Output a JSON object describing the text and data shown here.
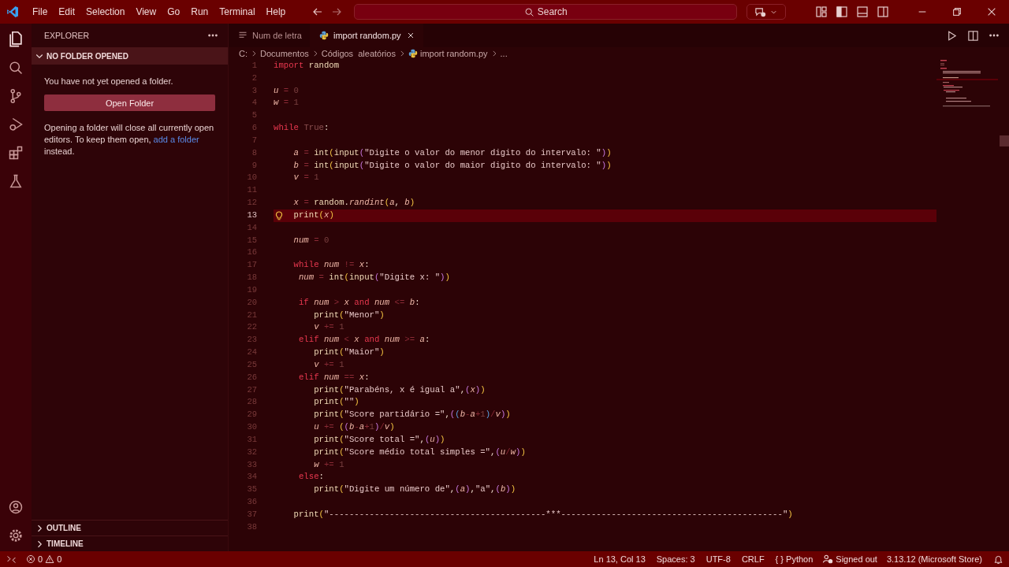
{
  "title_bar": {
    "menus": [
      "File",
      "Edit",
      "Selection",
      "View",
      "Go",
      "Run",
      "Terminal",
      "Help"
    ],
    "search": {
      "placeholder": "Search"
    }
  },
  "explorer": {
    "title": "EXPLORER",
    "section": {
      "title": "NO FOLDER OPENED",
      "expanded": true,
      "message": "You have not yet opened a folder.",
      "button": "Open Folder",
      "note_before": "Opening a folder will close all currently open editors. To keep them open, ",
      "note_link": "add a folder",
      "note_after": " instead."
    },
    "bottom_sections": [
      {
        "title": "OUTLINE",
        "expanded": false
      },
      {
        "title": "TIMELINE",
        "expanded": false
      }
    ]
  },
  "tabs": [
    {
      "label": "Num de letra",
      "kind": "text",
      "selected": false
    },
    {
      "label": "import random.py",
      "kind": "python",
      "selected": true
    }
  ],
  "breadcrumbs": [
    {
      "label": "C:",
      "kind": "folder"
    },
    {
      "label": "Documentos",
      "kind": "folder"
    },
    {
      "label": "Códigos  aleatórios",
      "kind": "folder"
    },
    {
      "label": "import random.py",
      "kind": "python"
    },
    {
      "label": "...",
      "kind": "more"
    }
  ],
  "editor": {
    "lines": [
      {
        "number": "1",
        "current": false,
        "tokens": [
          {
            "kind": "kw",
            "text": "import"
          },
          {
            "kind": "name",
            "text": " random"
          }
        ]
      },
      {
        "number": "2",
        "current": false
      },
      {
        "number": "3",
        "current": false,
        "tokens": [
          {
            "kind": "var",
            "text": "u"
          },
          {
            "kind": "op",
            "text": " = "
          },
          {
            "kind": "num",
            "text": "0"
          }
        ]
      },
      {
        "number": "4",
        "current": false,
        "tokens": [
          {
            "kind": "var",
            "text": "w"
          },
          {
            "kind": "op",
            "text": " = "
          },
          {
            "kind": "num",
            "text": "1"
          }
        ]
      },
      {
        "number": "5",
        "current": false
      },
      {
        "number": "6",
        "current": false,
        "tokens": [
          {
            "kind": "kw",
            "text": "while"
          },
          {
            "kind": "const",
            "text": " True"
          },
          {
            "kind": "punct",
            "text": ":"
          }
        ]
      },
      {
        "number": "7",
        "current": false
      },
      {
        "number": "8",
        "current": false,
        "tokens": [
          {
            "kind": "var",
            "text": "    a"
          },
          {
            "kind": "op",
            "text": " = "
          },
          {
            "kind": "name",
            "text": "int"
          },
          {
            "kind": "paren",
            "text": "("
          },
          {
            "kind": "name",
            "text": "input"
          },
          {
            "kind": "paren2",
            "text": "("
          },
          {
            "kind": "str",
            "text": "\"Digite o valor do menor digito do intervalo: \""
          },
          {
            "kind": "paren2",
            "text": ")"
          },
          {
            "kind": "paren",
            "text": ")"
          }
        ]
      },
      {
        "number": "9",
        "current": false,
        "tokens": [
          {
            "kind": "var",
            "text": "    b"
          },
          {
            "kind": "op",
            "text": " = "
          },
          {
            "kind": "name",
            "text": "int"
          },
          {
            "kind": "paren",
            "text": "("
          },
          {
            "kind": "name",
            "text": "input"
          },
          {
            "kind": "paren2",
            "text": "("
          },
          {
            "kind": "str",
            "text": "\"Digite o valor do maior digito do intervalo: \""
          },
          {
            "kind": "paren2",
            "text": ")"
          },
          {
            "kind": "paren",
            "text": ")"
          }
        ]
      },
      {
        "number": "10",
        "current": false,
        "tokens": [
          {
            "kind": "var",
            "text": "    v"
          },
          {
            "kind": "op",
            "text": " = "
          },
          {
            "kind": "num",
            "text": "1"
          }
        ]
      },
      {
        "number": "11",
        "current": false
      },
      {
        "number": "12",
        "current": false,
        "tokens": [
          {
            "kind": "var",
            "text": "    x"
          },
          {
            "kind": "op",
            "text": " = "
          },
          {
            "kind": "name",
            "text": "random"
          },
          {
            "kind": "punct",
            "text": "."
          },
          {
            "kind": "method",
            "text": "randint"
          },
          {
            "kind": "paren",
            "text": "("
          },
          {
            "kind": "var",
            "text": "a"
          },
          {
            "kind": "punct",
            "text": ", "
          },
          {
            "kind": "var",
            "text": "b"
          },
          {
            "kind": "paren",
            "text": ")"
          }
        ]
      },
      {
        "number": "13",
        "current": true,
        "tokens": [
          {
            "kind": "name",
            "text": "    print"
          },
          {
            "kind": "paren",
            "text": "("
          },
          {
            "kind": "var",
            "text": "x"
          },
          {
            "kind": "paren",
            "text": ")"
          }
        ]
      },
      {
        "number": "14",
        "current": false
      },
      {
        "number": "15",
        "current": false,
        "tokens": [
          {
            "kind": "var",
            "text": "    num"
          },
          {
            "kind": "op",
            "text": " = "
          },
          {
            "kind": "num",
            "text": "0"
          }
        ]
      },
      {
        "number": "16",
        "current": false
      },
      {
        "number": "17",
        "current": false,
        "tokens": [
          {
            "kind": "kw",
            "text": "    while"
          },
          {
            "kind": "var",
            "text": " num"
          },
          {
            "kind": "op",
            "text": " != "
          },
          {
            "kind": "var",
            "text": "x"
          },
          {
            "kind": "punct",
            "text": ":"
          }
        ]
      },
      {
        "number": "18",
        "current": false,
        "tokens": [
          {
            "kind": "var",
            "text": "     num"
          },
          {
            "kind": "op",
            "text": " = "
          },
          {
            "kind": "name",
            "text": "int"
          },
          {
            "kind": "paren",
            "text": "("
          },
          {
            "kind": "name",
            "text": "input"
          },
          {
            "kind": "paren2",
            "text": "("
          },
          {
            "kind": "str",
            "text": "\"Digite x: \""
          },
          {
            "kind": "paren2",
            "text": ")"
          },
          {
            "kind": "paren",
            "text": ")"
          }
        ]
      },
      {
        "number": "19",
        "current": false
      },
      {
        "number": "20",
        "current": false,
        "tokens": [
          {
            "kind": "kw",
            "text": "     if"
          },
          {
            "kind": "var",
            "text": " num"
          },
          {
            "kind": "op",
            "text": " > "
          },
          {
            "kind": "var",
            "text": "x"
          },
          {
            "kind": "kw",
            "text": " and"
          },
          {
            "kind": "var",
            "text": " num"
          },
          {
            "kind": "op",
            "text": " <= "
          },
          {
            "kind": "var",
            "text": "b"
          },
          {
            "kind": "punct",
            "text": ":"
          }
        ]
      },
      {
        "number": "21",
        "current": false,
        "tokens": [
          {
            "kind": "name",
            "text": "        print"
          },
          {
            "kind": "paren",
            "text": "("
          },
          {
            "kind": "str",
            "text": "\"Menor\""
          },
          {
            "kind": "paren",
            "text": ")"
          }
        ]
      },
      {
        "number": "22",
        "current": false,
        "tokens": [
          {
            "kind": "var",
            "text": "        v"
          },
          {
            "kind": "op",
            "text": " += "
          },
          {
            "kind": "num",
            "text": "1"
          }
        ]
      },
      {
        "number": "23",
        "current": false,
        "tokens": [
          {
            "kind": "kw",
            "text": "     elif"
          },
          {
            "kind": "var",
            "text": " num"
          },
          {
            "kind": "op",
            "text": " < "
          },
          {
            "kind": "var",
            "text": "x"
          },
          {
            "kind": "kw",
            "text": " and"
          },
          {
            "kind": "var",
            "text": " num"
          },
          {
            "kind": "op",
            "text": " >= "
          },
          {
            "kind": "var",
            "text": "a"
          },
          {
            "kind": "punct",
            "text": ":"
          }
        ]
      },
      {
        "number": "24",
        "current": false,
        "tokens": [
          {
            "kind": "name",
            "text": "        print"
          },
          {
            "kind": "paren",
            "text": "("
          },
          {
            "kind": "str",
            "text": "\"Maior\""
          },
          {
            "kind": "paren",
            "text": ")"
          }
        ]
      },
      {
        "number": "25",
        "current": false,
        "tokens": [
          {
            "kind": "var",
            "text": "        v"
          },
          {
            "kind": "op",
            "text": " += "
          },
          {
            "kind": "num",
            "text": "1"
          }
        ]
      },
      {
        "number": "26",
        "current": false,
        "tokens": [
          {
            "kind": "kw",
            "text": "     elif"
          },
          {
            "kind": "var",
            "text": " num"
          },
          {
            "kind": "op",
            "text": " == "
          },
          {
            "kind": "var",
            "text": "x"
          },
          {
            "kind": "punct",
            "text": ":"
          }
        ]
      },
      {
        "number": "27",
        "current": false,
        "tokens": [
          {
            "kind": "name",
            "text": "        print"
          },
          {
            "kind": "paren",
            "text": "("
          },
          {
            "kind": "str",
            "text": "\"Parabéns, x é igual a\""
          },
          {
            "kind": "punct",
            "text": ","
          },
          {
            "kind": "paren2",
            "text": "("
          },
          {
            "kind": "var",
            "text": "x"
          },
          {
            "kind": "paren2",
            "text": ")"
          },
          {
            "kind": "paren",
            "text": ")"
          }
        ]
      },
      {
        "number": "28",
        "current": false,
        "tokens": [
          {
            "kind": "name",
            "text": "        print"
          },
          {
            "kind": "paren",
            "text": "("
          },
          {
            "kind": "str",
            "text": "\"\""
          },
          {
            "kind": "paren",
            "text": ")"
          }
        ]
      },
      {
        "number": "29",
        "current": false,
        "tokens": [
          {
            "kind": "name",
            "text": "        print"
          },
          {
            "kind": "paren",
            "text": "("
          },
          {
            "kind": "str",
            "text": "\"Score partidário =\""
          },
          {
            "kind": "punct",
            "text": ","
          },
          {
            "kind": "paren2",
            "text": "("
          },
          {
            "kind": "paren3",
            "text": "("
          },
          {
            "kind": "var",
            "text": "b"
          },
          {
            "kind": "op",
            "text": "-"
          },
          {
            "kind": "var",
            "text": "a"
          },
          {
            "kind": "op",
            "text": "+"
          },
          {
            "kind": "num",
            "text": "1"
          },
          {
            "kind": "paren3",
            "text": ")"
          },
          {
            "kind": "op",
            "text": "/"
          },
          {
            "kind": "var",
            "text": "v"
          },
          {
            "kind": "paren2",
            "text": ")"
          },
          {
            "kind": "paren",
            "text": ")"
          }
        ]
      },
      {
        "number": "30",
        "current": false,
        "tokens": [
          {
            "kind": "var",
            "text": "        u"
          },
          {
            "kind": "op",
            "text": " += "
          },
          {
            "kind": "paren",
            "text": "("
          },
          {
            "kind": "paren2",
            "text": "("
          },
          {
            "kind": "var",
            "text": "b"
          },
          {
            "kind": "op",
            "text": "-"
          },
          {
            "kind": "var",
            "text": "a"
          },
          {
            "kind": "op",
            "text": "+"
          },
          {
            "kind": "num",
            "text": "1"
          },
          {
            "kind": "paren2",
            "text": ")"
          },
          {
            "kind": "op",
            "text": "/"
          },
          {
            "kind": "var",
            "text": "v"
          },
          {
            "kind": "paren",
            "text": ")"
          }
        ]
      },
      {
        "number": "31",
        "current": false,
        "tokens": [
          {
            "kind": "name",
            "text": "        print"
          },
          {
            "kind": "paren",
            "text": "("
          },
          {
            "kind": "str",
            "text": "\"Score total =\""
          },
          {
            "kind": "punct",
            "text": ","
          },
          {
            "kind": "paren2",
            "text": "("
          },
          {
            "kind": "var",
            "text": "u"
          },
          {
            "kind": "paren2",
            "text": ")"
          },
          {
            "kind": "paren",
            "text": ")"
          }
        ]
      },
      {
        "number": "32",
        "current": false,
        "tokens": [
          {
            "kind": "name",
            "text": "        print"
          },
          {
            "kind": "paren",
            "text": "("
          },
          {
            "kind": "str",
            "text": "\"Score médio total simples =\""
          },
          {
            "kind": "punct",
            "text": ","
          },
          {
            "kind": "paren2",
            "text": "("
          },
          {
            "kind": "var",
            "text": "u"
          },
          {
            "kind": "op",
            "text": "/"
          },
          {
            "kind": "var",
            "text": "w"
          },
          {
            "kind": "paren2",
            "text": ")"
          },
          {
            "kind": "paren",
            "text": ")"
          }
        ]
      },
      {
        "number": "33",
        "current": false,
        "tokens": [
          {
            "kind": "var",
            "text": "        w"
          },
          {
            "kind": "op",
            "text": " += "
          },
          {
            "kind": "num",
            "text": "1"
          }
        ]
      },
      {
        "number": "34",
        "current": false,
        "tokens": [
          {
            "kind": "kw",
            "text": "     else"
          },
          {
            "kind": "punct",
            "text": ":"
          }
        ]
      },
      {
        "number": "35",
        "current": false,
        "tokens": [
          {
            "kind": "name",
            "text": "        print"
          },
          {
            "kind": "paren",
            "text": "("
          },
          {
            "kind": "str",
            "text": "\"Digite um número de\""
          },
          {
            "kind": "punct",
            "text": ","
          },
          {
            "kind": "paren2",
            "text": "("
          },
          {
            "kind": "var",
            "text": "a"
          },
          {
            "kind": "paren2",
            "text": ")"
          },
          {
            "kind": "punct",
            "text": ","
          },
          {
            "kind": "str",
            "text": "\"a\""
          },
          {
            "kind": "punct",
            "text": ","
          },
          {
            "kind": "paren2",
            "text": "("
          },
          {
            "kind": "var",
            "text": "b"
          },
          {
            "kind": "paren2",
            "text": ")"
          },
          {
            "kind": "paren",
            "text": ")"
          }
        ]
      },
      {
        "number": "36",
        "current": false
      },
      {
        "number": "37",
        "current": false,
        "tokens": [
          {
            "kind": "name",
            "text": "    print"
          },
          {
            "kind": "paren",
            "text": "("
          },
          {
            "kind": "str",
            "text": "\"-------------------------------------------***--------------------------------------------\""
          },
          {
            "kind": "paren",
            "text": ")"
          }
        ]
      },
      {
        "number": "38",
        "current": false
      }
    ]
  },
  "status_bar": {
    "errors": "0",
    "warnings": "0",
    "items": [
      "Ln 13, Col 13",
      "Spaces: 3",
      "UTF-8",
      "CRLF"
    ],
    "language_icon": "{ }",
    "language": "Python",
    "account": "Signed out",
    "interpreter": "3.13.12 (Microsoft Store)"
  }
}
